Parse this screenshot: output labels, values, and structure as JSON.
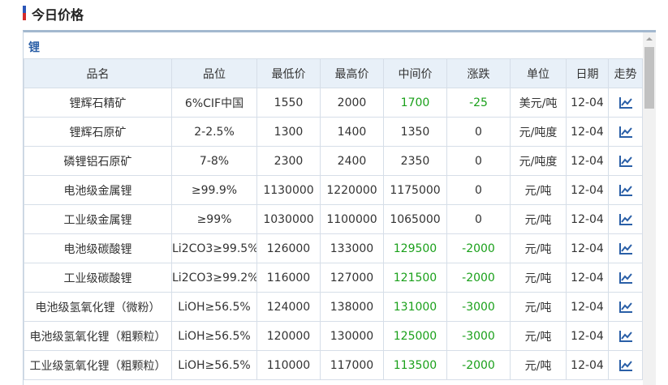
{
  "header": {
    "title": "今日价格",
    "marker_colors": [
      "#2b56b8",
      "#d32a2a"
    ]
  },
  "section": {
    "label": "锂"
  },
  "table": {
    "columns": [
      "品名",
      "品位",
      "最低价",
      "最高价",
      "中间价",
      "涨跌",
      "单位",
      "日期",
      "走势"
    ],
    "rows": [
      {
        "name": "锂辉石精矿",
        "grade": "6%CIF中国",
        "low": "1550",
        "high": "2000",
        "mid": "1700",
        "change": "-25",
        "unit": "美元/吨",
        "date": "12-04",
        "highlight": true
      },
      {
        "name": "锂辉石原矿",
        "grade": "2-2.5%",
        "low": "1300",
        "high": "1400",
        "mid": "1350",
        "change": "0",
        "unit": "元/吨度",
        "date": "12-04",
        "highlight": false
      },
      {
        "name": "磷锂铝石原矿",
        "grade": "7-8%",
        "low": "2300",
        "high": "2400",
        "mid": "2350",
        "change": "0",
        "unit": "元/吨度",
        "date": "12-04",
        "highlight": false
      },
      {
        "name": "电池级金属锂",
        "grade": "≥99.9%",
        "low": "1130000",
        "high": "1220000",
        "mid": "1175000",
        "change": "0",
        "unit": "元/吨",
        "date": "12-04",
        "highlight": false
      },
      {
        "name": "工业级金属锂",
        "grade": "≥99%",
        "low": "1030000",
        "high": "1100000",
        "mid": "1065000",
        "change": "0",
        "unit": "元/吨",
        "date": "12-04",
        "highlight": false
      },
      {
        "name": "电池级碳酸锂",
        "grade": "Li2CO3≥99.5%",
        "low": "126000",
        "high": "133000",
        "mid": "129500",
        "change": "-2000",
        "unit": "元/吨",
        "date": "12-04",
        "highlight": true
      },
      {
        "name": "工业级碳酸锂",
        "grade": "Li2CO3≥99.2%",
        "low": "116000",
        "high": "127000",
        "mid": "121500",
        "change": "-2000",
        "unit": "元/吨",
        "date": "12-04",
        "highlight": true
      },
      {
        "name": "电池级氢氧化锂（微粉）",
        "grade": "LiOH≥56.5%",
        "low": "124000",
        "high": "138000",
        "mid": "131000",
        "change": "-3000",
        "unit": "元/吨",
        "date": "12-04",
        "highlight": true
      },
      {
        "name": "电池级氢氧化锂（粗颗粒）",
        "grade": "LiOH≥56.5%",
        "low": "120000",
        "high": "130000",
        "mid": "125000",
        "change": "-3000",
        "unit": "元/吨",
        "date": "12-04",
        "highlight": true
      },
      {
        "name": "工业级氢氧化锂（粗颗粒）",
        "grade": "LiOH≥56.5%",
        "low": "110000",
        "high": "117000",
        "mid": "113500",
        "change": "-2000",
        "unit": "元/吨",
        "date": "12-04",
        "highlight": true
      }
    ]
  },
  "icons": {
    "trend": "trend-chart-icon"
  },
  "colors": {
    "accent": "#2a5fa7",
    "header_bg": "#e8f0f8",
    "positive": "#1aa01a",
    "border": "#d6dee8"
  }
}
